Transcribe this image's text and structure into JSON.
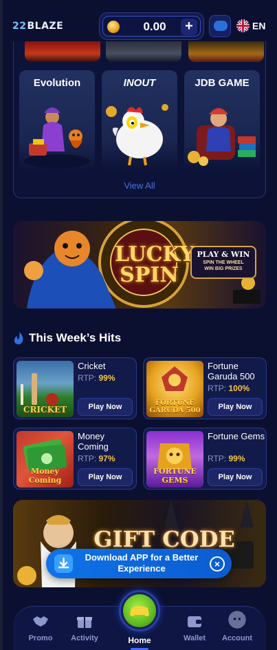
{
  "header": {
    "logo_text": "BLAZE",
    "logo_prefix": "22",
    "balance": "0.00",
    "language": "EN"
  },
  "providers": {
    "items": [
      {
        "name": "Evolution"
      },
      {
        "name": "INOUT"
      },
      {
        "name": "JDB GAME"
      }
    ],
    "view_all": "View All"
  },
  "banners": {
    "lucky_spin": {
      "title_line1": "LUCKY",
      "title_line2": "SPIN",
      "play_win": "PLAY & WIN",
      "sub1": "SPIN THE WHEEL",
      "sub2": "WIN BIG PRIZES"
    },
    "gift_code": {
      "title": "GIFT CODE"
    }
  },
  "hits": {
    "title": "This Week’s Hits",
    "rtp_label": "RTP:",
    "play_label": "Play Now",
    "games": [
      {
        "name": "Cricket",
        "rtp": "99%",
        "thumb_text": "CRICKET"
      },
      {
        "name": "Fortune Garuda 500",
        "rtp": "100%",
        "thumb_text": "FORTUNE GARUDA 500"
      },
      {
        "name": "Money Coming",
        "rtp": "97%",
        "thumb_text": "Money Coming"
      },
      {
        "name": "Fortune Gems",
        "rtp": "99%",
        "thumb_text": "FORTUNE GEMS"
      }
    ]
  },
  "toast": {
    "text": "Download APP for a Better Experience"
  },
  "nav": {
    "items": [
      {
        "label": "Promo"
      },
      {
        "label": "Activity"
      },
      {
        "label": "Home"
      },
      {
        "label": "Wallet"
      },
      {
        "label": "Account"
      }
    ]
  },
  "colors": {
    "background": "#0b1030",
    "accent_blue": "#0f73e8",
    "rtp_gold": "#f5c542",
    "home_green": "#53b01a"
  }
}
